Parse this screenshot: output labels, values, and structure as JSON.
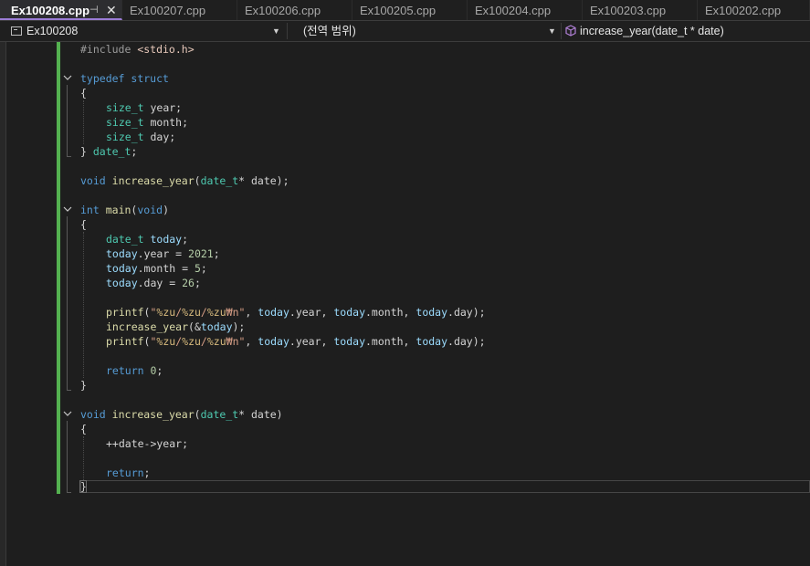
{
  "tabs": [
    {
      "label": "Ex100208.cpp",
      "active": true
    },
    {
      "label": "Ex100207.cpp"
    },
    {
      "label": "Ex100206.cpp"
    },
    {
      "label": "Ex100205.cpp"
    },
    {
      "label": "Ex100204.cpp"
    },
    {
      "label": "Ex100203.cpp"
    },
    {
      "label": "Ex100202.cpp"
    }
  ],
  "icons": {
    "pin": "pin-icon",
    "close": "close-icon",
    "project": "project-icon",
    "method": "method-cube-icon",
    "dropdown": "chevron-down-icon",
    "fold": "collapse-chevron-icon"
  },
  "navbar": {
    "project": "Ex100208",
    "scope": "(전역 범위)",
    "member": "increase_year(date_t * date)"
  },
  "colors": {
    "accent": "#9b7cd6",
    "change_bar": "#54b150",
    "keyword": "#569cd6",
    "type": "#4ec9b0",
    "function": "#dcdcaa",
    "string": "#d69d85",
    "number": "#b5cea8",
    "variable": "#9cdcfe"
  },
  "code": {
    "l1": {
      "a": "#include ",
      "b": "<stdio.h>"
    },
    "l3": {
      "a": "typedef",
      "b": " ",
      "c": "struct"
    },
    "l4": "{",
    "l5": {
      "a": "size_t",
      "b": " year;"
    },
    "l6": {
      "a": "size_t",
      "b": " month;"
    },
    "l7": {
      "a": "size_t",
      "b": " day;"
    },
    "l8": {
      "a": "} ",
      "b": "date_t",
      "c": ";"
    },
    "l10": {
      "a": "void",
      "b": " ",
      "c": "increase_year",
      "d": "(",
      "e": "date_t",
      "f": "* date);"
    },
    "l12": {
      "a": "int",
      "b": " ",
      "c": "main",
      "d": "(",
      "e": "void",
      "f": ")"
    },
    "l13": "{",
    "l14": {
      "a": "date_t",
      "b": " ",
      "c": "today",
      "d": ";"
    },
    "l15": {
      "a": "today",
      "b": ".year = ",
      "c": "2021",
      "d": ";"
    },
    "l16": {
      "a": "today",
      "b": ".month = ",
      "c": "5",
      "d": ";"
    },
    "l17": {
      "a": "today",
      "b": ".day = ",
      "c": "26",
      "d": ";"
    },
    "l19": {
      "a": "printf",
      "b": "(",
      "c": "\"",
      "d": "%zu",
      "e": "/",
      "f": "%zu",
      "g": "/",
      "h": "%zu",
      "i": "₩n\"",
      "j": ", ",
      "k": "today",
      "l": ".year, ",
      "m": "today",
      "n": ".month, ",
      "o": "today",
      "p": ".day);"
    },
    "l20": {
      "a": "increase_year",
      "b": "(&",
      "c": "today",
      "d": ");"
    },
    "l21": {
      "a": "printf",
      "b": "(",
      "c": "\"",
      "d": "%zu",
      "e": "/",
      "f": "%zu",
      "g": "/",
      "h": "%zu",
      "i": "₩n\"",
      "j": ", ",
      "k": "today",
      "l": ".year, ",
      "m": "today",
      "n": ".month, ",
      "o": "today",
      "p": ".day);"
    },
    "l23": {
      "a": "return",
      "b": " ",
      "c": "0",
      "d": ";"
    },
    "l24": "}",
    "l26": {
      "a": "void",
      "b": " ",
      "c": "increase_year",
      "d": "(",
      "e": "date_t",
      "f": "* date)"
    },
    "l27": "{",
    "l28": "++date->year;",
    "l30": {
      "a": "return",
      "b": ";"
    },
    "l31": "}"
  }
}
